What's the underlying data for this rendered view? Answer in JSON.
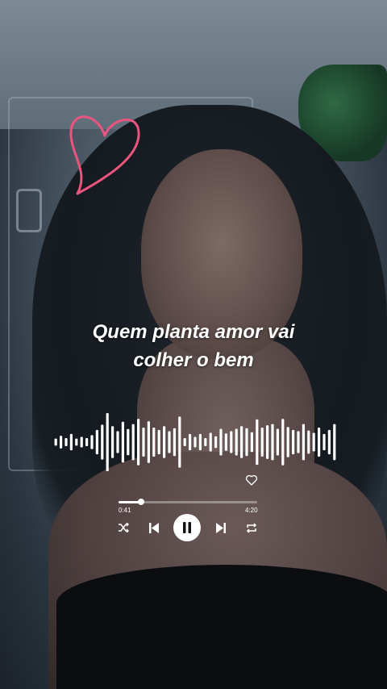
{
  "lyrics": {
    "line1": "Quem planta amor vai",
    "line2": "colher o bem"
  },
  "player": {
    "elapsed": "0:41",
    "total": "4:20",
    "progress_fraction": 0.16,
    "liked": false,
    "state": "playing"
  },
  "waveform": {
    "bars": [
      0.12,
      0.22,
      0.14,
      0.28,
      0.12,
      0.18,
      0.14,
      0.24,
      0.42,
      0.6,
      1.0,
      0.55,
      0.38,
      0.7,
      0.45,
      0.62,
      0.8,
      0.5,
      0.72,
      0.5,
      0.42,
      0.55,
      0.38,
      0.48,
      0.88,
      0.14,
      0.28,
      0.18,
      0.28,
      0.14,
      0.32,
      0.2,
      0.46,
      0.3,
      0.38,
      0.46,
      0.55,
      0.48,
      0.34,
      0.78,
      0.5,
      0.58,
      0.62,
      0.46,
      0.8,
      0.52,
      0.42,
      0.38,
      0.62,
      0.4,
      0.32,
      0.5,
      0.28,
      0.42,
      0.62
    ]
  },
  "colors": {
    "accent": "#ffffff",
    "heart_sticker": "#e9557e"
  },
  "icons": {
    "heart_sticker": "heart-outline-sticker",
    "like": "heart-outline-icon",
    "shuffle": "shuffle-icon",
    "previous": "skip-previous-icon",
    "play_pause": "pause-icon",
    "next": "skip-next-icon",
    "repeat": "repeat-icon"
  }
}
